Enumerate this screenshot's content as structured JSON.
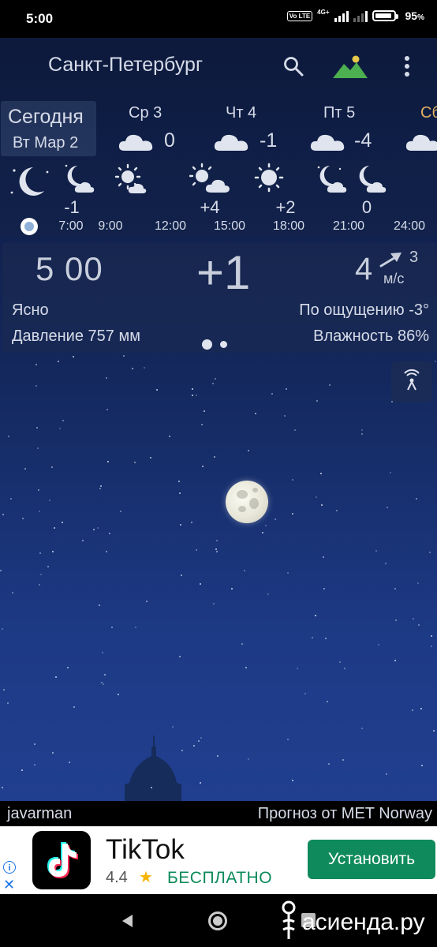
{
  "status_bar": {
    "time": "5:00",
    "volte": "Vo LTE",
    "network": "4G+",
    "battery": "95",
    "battery_unit": "%"
  },
  "app_bar": {
    "city": "Санкт-Петербург"
  },
  "days": {
    "today": {
      "label": "Сегодня",
      "date": "Вт Мар 2"
    },
    "items": [
      {
        "name": "Ср 3",
        "temp": "0"
      },
      {
        "name": "Чт 4",
        "temp": "-1"
      },
      {
        "name": "Пт 5",
        "temp": "-4"
      },
      {
        "name": "Сб"
      }
    ]
  },
  "hourly": {
    "temps": [
      "-1",
      "+4",
      "+2",
      "0"
    ],
    "times": [
      "7:00",
      "9:00",
      "12:00",
      "15:00",
      "18:00",
      "21:00",
      "24:00"
    ]
  },
  "current": {
    "time": "5 00",
    "temp": "+1",
    "wind_speed": "4",
    "wind_gust": "3",
    "wind_unit": "м/с",
    "condition": "Ясно",
    "feels_like": "По ощущению -3°",
    "pressure": "Давление 757 мм",
    "humidity": "Влажность 86%"
  },
  "credits": {
    "left": "javarman",
    "right": "Прогноз от MET Norway"
  },
  "ad": {
    "title": "TikTok",
    "rating": "4.4",
    "star": "★",
    "price": "БЕСПЛАТНО",
    "install": "Установить",
    "info": "i",
    "close": "✕"
  },
  "watermark": {
    "text": "асиенда.ру"
  },
  "colors": {
    "sky_top": "#0c1838",
    "sky_bottom": "#213f8f",
    "install_button": "#0f8a5c",
    "day_gold": "#e0b060"
  }
}
